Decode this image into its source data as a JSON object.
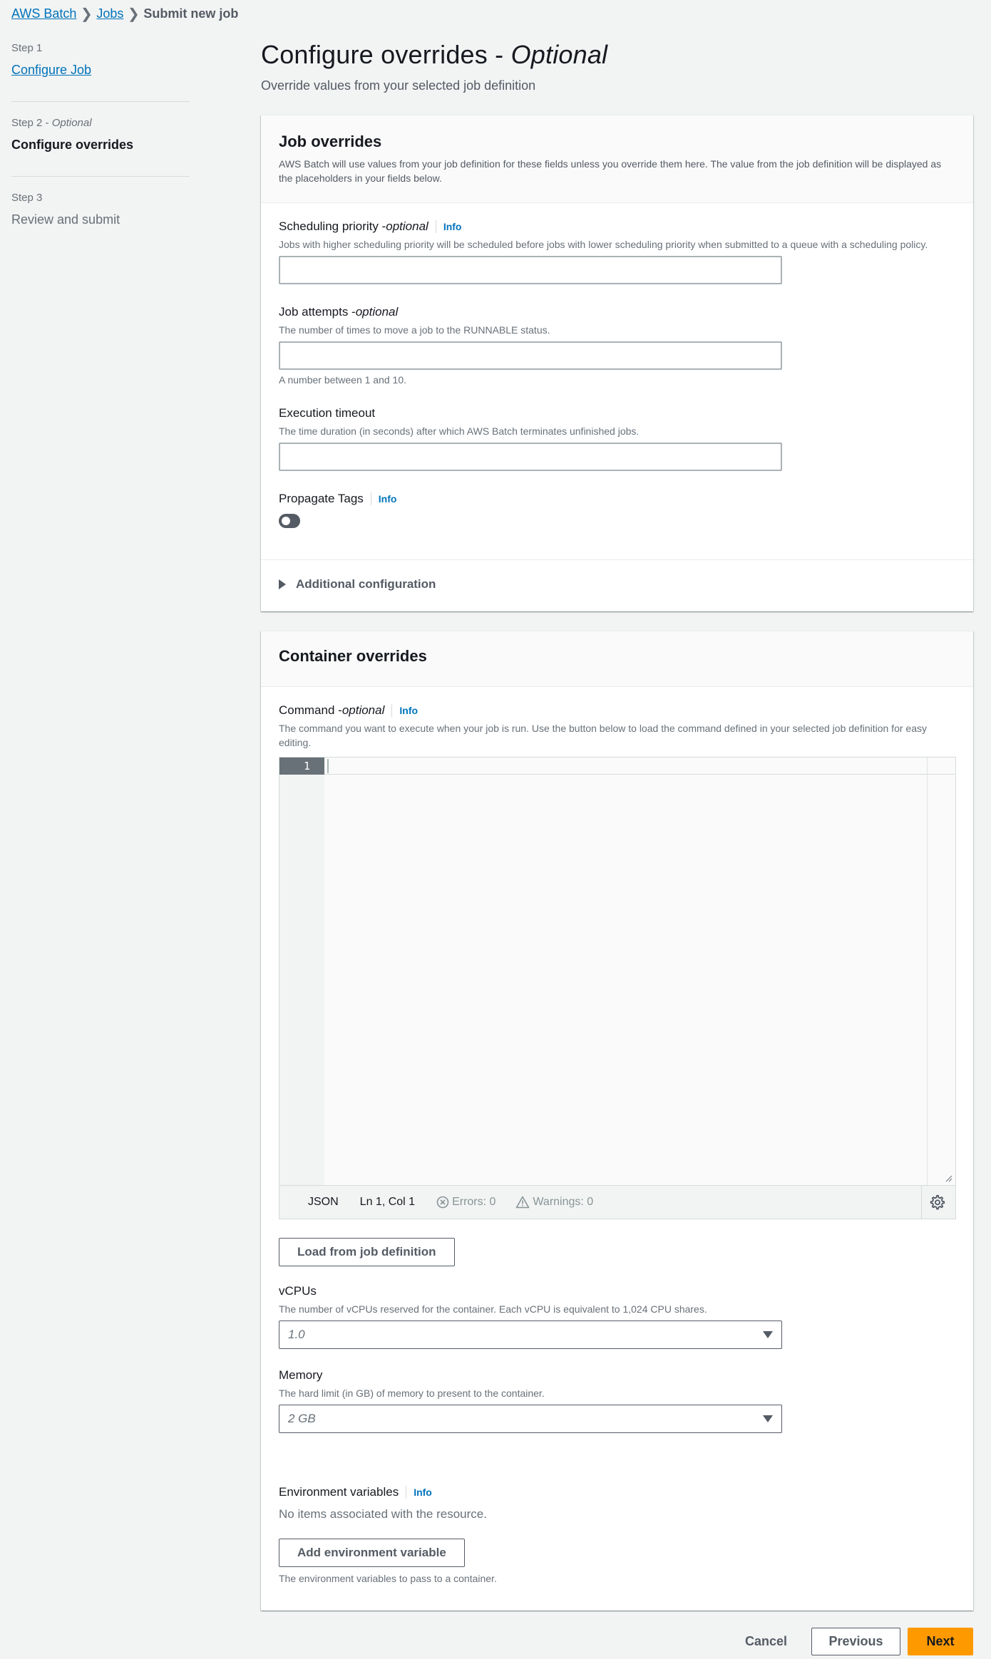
{
  "breadcrumb": {
    "items": [
      {
        "label": "AWS Batch"
      },
      {
        "label": "Jobs"
      },
      {
        "label": "Submit new job"
      }
    ]
  },
  "wizard_nav": {
    "steps": [
      {
        "number": "Step 1",
        "number_suffix": "",
        "title": "Configure Job",
        "state": "link"
      },
      {
        "number": "Step 2 - ",
        "number_suffix": "Optional",
        "title": "Configure overrides",
        "state": "active"
      },
      {
        "number": "Step 3",
        "number_suffix": "",
        "title": "Review and submit",
        "state": "disabled"
      }
    ]
  },
  "page": {
    "title": "Configure overrides - ",
    "title_suffix": "Optional",
    "description": "Override values from your selected job definition"
  },
  "job_overrides": {
    "title": "Job overrides",
    "description": "AWS Batch will use values from your job definition for these fields unless you override them here. The value from the job definition will be displayed as the placeholders in your fields below.",
    "scheduling_priority": {
      "label": "Scheduling priority - ",
      "label_suffix": "optional",
      "info": "Info",
      "description": "Jobs with higher scheduling priority will be scheduled before jobs with lower scheduling priority when submitted to a queue with a scheduling policy.",
      "value": "",
      "placeholder": ""
    },
    "job_attempts": {
      "label": "Job attempts - ",
      "label_suffix": "optional",
      "description": "The number of times to move a job to the RUNNABLE status.",
      "value": "",
      "placeholder": "",
      "hint": "A number between 1 and 10."
    },
    "execution_timeout": {
      "label": "Execution timeout",
      "description": "The time duration (in seconds) after which AWS Batch terminates unfinished jobs.",
      "value": "",
      "placeholder": ""
    },
    "propagate_tags": {
      "label": "Propagate Tags",
      "info": "Info",
      "enabled": false
    },
    "additional_configuration": {
      "label": "Additional configuration",
      "expanded": false
    }
  },
  "container_overrides": {
    "title": "Container overrides",
    "command": {
      "label": "Command - ",
      "label_suffix": "optional",
      "info": "Info",
      "description": "The command you want to execute when your job is run. Use the button below to load the command defined in your selected job definition for easy editing.",
      "editor": {
        "line_numbers": [
          "1"
        ],
        "content": "",
        "language": "JSON",
        "position": "Ln 1, Col 1",
        "errors": "Errors: 0",
        "warnings": "Warnings: 0"
      },
      "load_button": "Load from job definition"
    },
    "vcpus": {
      "label": "vCPUs",
      "description": "The number of vCPUs reserved for the container. Each vCPU is equivalent to 1,024 CPU shares.",
      "selected": "1.0"
    },
    "memory": {
      "label": "Memory",
      "description": "The hard limit (in GB) of memory to present to the container.",
      "selected": "2 GB"
    },
    "env_vars": {
      "label": "Environment variables",
      "info": "Info",
      "empty_text": "No items associated with the resource.",
      "add_button": "Add environment variable",
      "hint": "The environment variables to pass to a container."
    }
  },
  "actions": {
    "cancel": "Cancel",
    "previous": "Previous",
    "next": "Next"
  },
  "colors": {
    "link": "#0073bb",
    "primary_button": "#ff9900",
    "background": "#f2f3f3"
  }
}
